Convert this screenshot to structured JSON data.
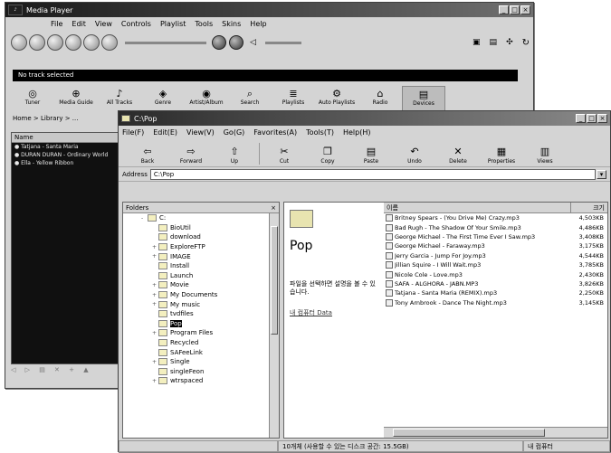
{
  "media_player": {
    "title": "Media Player",
    "menu": [
      "File",
      "Edit",
      "View",
      "Controls",
      "Playlist",
      "Tools",
      "Skins",
      "Help"
    ],
    "status_text": "No track selected",
    "tasks": [
      {
        "label": "Tuner",
        "icon": "radio"
      },
      {
        "label": "Media Guide",
        "icon": "globe"
      },
      {
        "label": "All Tracks",
        "icon": "note"
      },
      {
        "label": "Genre",
        "icon": "tag"
      },
      {
        "label": "Artist/Album",
        "icon": "cd"
      },
      {
        "label": "Search",
        "icon": "search"
      },
      {
        "label": "Playlists",
        "icon": "list"
      },
      {
        "label": "Auto Playlists",
        "icon": "auto"
      },
      {
        "label": "Radio",
        "icon": "radio2"
      },
      {
        "label": "Devices",
        "icon": "device"
      }
    ],
    "breadcrumb": "Home > Library > ...",
    "playlist_header": "Name",
    "playlist": [
      "Tatjana - Santa Maria",
      "DURAN DURAN - Ordinary World",
      "Ella - Yellow Ribbon"
    ]
  },
  "explorer": {
    "title": "C:\\Pop",
    "menu": [
      "File(F)",
      "Edit(E)",
      "View(V)",
      "Go(G)",
      "Favorites(A)",
      "Tools(T)",
      "Help(H)"
    ],
    "toolbar": [
      "Back",
      "Forward",
      "Up",
      "Cut",
      "Copy",
      "Paste",
      "Undo",
      "Delete",
      "Properties",
      "Views"
    ],
    "address_label": "Address",
    "address": "C:\\Pop",
    "tree_header": "Folders",
    "tree": [
      {
        "label": "C:",
        "level": 0,
        "expand": "-"
      },
      {
        "label": "BioUtil",
        "level": 1,
        "expand": ""
      },
      {
        "label": "download",
        "level": 1,
        "expand": ""
      },
      {
        "label": "ExploreFTP",
        "level": 1,
        "expand": "+"
      },
      {
        "label": "IMAGE",
        "level": 1,
        "expand": "+"
      },
      {
        "label": "Install",
        "level": 1,
        "expand": ""
      },
      {
        "label": "Launch",
        "level": 1,
        "expand": ""
      },
      {
        "label": "Movie",
        "level": 1,
        "expand": "+"
      },
      {
        "label": "My Documents",
        "level": 1,
        "expand": "+"
      },
      {
        "label": "My music",
        "level": 1,
        "expand": "+"
      },
      {
        "label": "tvdfiles",
        "level": 1,
        "expand": ""
      },
      {
        "label": "Pop",
        "level": 1,
        "expand": "",
        "selected": true
      },
      {
        "label": "Program Files",
        "level": 1,
        "expand": "+"
      },
      {
        "label": "Recycled",
        "level": 1,
        "expand": ""
      },
      {
        "label": "SAFeeLink",
        "level": 1,
        "expand": ""
      },
      {
        "label": "Single",
        "level": 1,
        "expand": "+"
      },
      {
        "label": "singleFeon",
        "level": 1,
        "expand": ""
      },
      {
        "label": "wtrspaced",
        "level": 1,
        "expand": "+"
      }
    ],
    "folder_name": "Pop",
    "folder_desc": "파일을 선택하면 설명을 볼 수 있습니다.",
    "folder_link": "내 컴퓨터 Data",
    "col_name": "이름",
    "col_size": "크기",
    "files": [
      {
        "name": "Britney Spears - (You Drive Me) Crazy.mp3",
        "size": "4,503KB"
      },
      {
        "name": "Bad Rugh - The Shadow Of Your Smile.mp3",
        "size": "4,486KB"
      },
      {
        "name": "George Michael - The First Time Ever I Saw.mp3",
        "size": "3,408KB"
      },
      {
        "name": "George Michael - Faraway.mp3",
        "size": "3,175KB"
      },
      {
        "name": "Jerry Garcia - Jump For Joy.mp3",
        "size": "4,544KB"
      },
      {
        "name": "Jillian Squire - I Will Wait.mp3",
        "size": "3,785KB"
      },
      {
        "name": "Nicole Cole - Love.mp3",
        "size": "2,430KB"
      },
      {
        "name": "SAFA - ALGHORA - JABN.MP3",
        "size": "3,826KB"
      },
      {
        "name": "Tatjana - Santa Maria (REMIX).mp3",
        "size": "2,250KB"
      },
      {
        "name": "Tony Arnbrook - Dance The Night.mp3",
        "size": "3,145KB"
      }
    ],
    "status_left": "",
    "status_mid": "10개체 (사용할 수 있는 디스크 공간: 15.5GB)",
    "status_right": "내 컴퓨터"
  }
}
